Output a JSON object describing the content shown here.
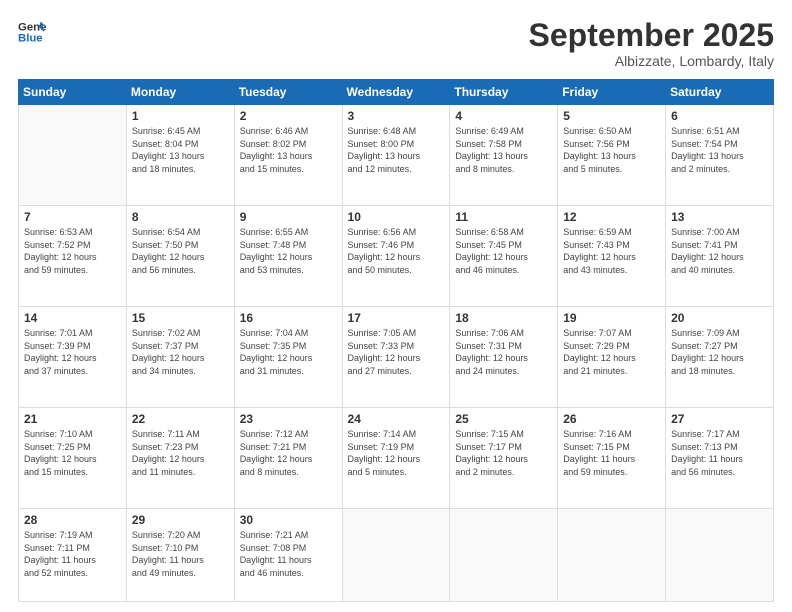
{
  "logo": {
    "line1": "General",
    "line2": "Blue"
  },
  "header": {
    "month": "September 2025",
    "location": "Albizzate, Lombardy, Italy"
  },
  "weekdays": [
    "Sunday",
    "Monday",
    "Tuesday",
    "Wednesday",
    "Thursday",
    "Friday",
    "Saturday"
  ],
  "weeks": [
    [
      {
        "day": "",
        "info": ""
      },
      {
        "day": "1",
        "info": "Sunrise: 6:45 AM\nSunset: 8:04 PM\nDaylight: 13 hours\nand 18 minutes."
      },
      {
        "day": "2",
        "info": "Sunrise: 6:46 AM\nSunset: 8:02 PM\nDaylight: 13 hours\nand 15 minutes."
      },
      {
        "day": "3",
        "info": "Sunrise: 6:48 AM\nSunset: 8:00 PM\nDaylight: 13 hours\nand 12 minutes."
      },
      {
        "day": "4",
        "info": "Sunrise: 6:49 AM\nSunset: 7:58 PM\nDaylight: 13 hours\nand 8 minutes."
      },
      {
        "day": "5",
        "info": "Sunrise: 6:50 AM\nSunset: 7:56 PM\nDaylight: 13 hours\nand 5 minutes."
      },
      {
        "day": "6",
        "info": "Sunrise: 6:51 AM\nSunset: 7:54 PM\nDaylight: 13 hours\nand 2 minutes."
      }
    ],
    [
      {
        "day": "7",
        "info": "Sunrise: 6:53 AM\nSunset: 7:52 PM\nDaylight: 12 hours\nand 59 minutes."
      },
      {
        "day": "8",
        "info": "Sunrise: 6:54 AM\nSunset: 7:50 PM\nDaylight: 12 hours\nand 56 minutes."
      },
      {
        "day": "9",
        "info": "Sunrise: 6:55 AM\nSunset: 7:48 PM\nDaylight: 12 hours\nand 53 minutes."
      },
      {
        "day": "10",
        "info": "Sunrise: 6:56 AM\nSunset: 7:46 PM\nDaylight: 12 hours\nand 50 minutes."
      },
      {
        "day": "11",
        "info": "Sunrise: 6:58 AM\nSunset: 7:45 PM\nDaylight: 12 hours\nand 46 minutes."
      },
      {
        "day": "12",
        "info": "Sunrise: 6:59 AM\nSunset: 7:43 PM\nDaylight: 12 hours\nand 43 minutes."
      },
      {
        "day": "13",
        "info": "Sunrise: 7:00 AM\nSunset: 7:41 PM\nDaylight: 12 hours\nand 40 minutes."
      }
    ],
    [
      {
        "day": "14",
        "info": "Sunrise: 7:01 AM\nSunset: 7:39 PM\nDaylight: 12 hours\nand 37 minutes."
      },
      {
        "day": "15",
        "info": "Sunrise: 7:02 AM\nSunset: 7:37 PM\nDaylight: 12 hours\nand 34 minutes."
      },
      {
        "day": "16",
        "info": "Sunrise: 7:04 AM\nSunset: 7:35 PM\nDaylight: 12 hours\nand 31 minutes."
      },
      {
        "day": "17",
        "info": "Sunrise: 7:05 AM\nSunset: 7:33 PM\nDaylight: 12 hours\nand 27 minutes."
      },
      {
        "day": "18",
        "info": "Sunrise: 7:06 AM\nSunset: 7:31 PM\nDaylight: 12 hours\nand 24 minutes."
      },
      {
        "day": "19",
        "info": "Sunrise: 7:07 AM\nSunset: 7:29 PM\nDaylight: 12 hours\nand 21 minutes."
      },
      {
        "day": "20",
        "info": "Sunrise: 7:09 AM\nSunset: 7:27 PM\nDaylight: 12 hours\nand 18 minutes."
      }
    ],
    [
      {
        "day": "21",
        "info": "Sunrise: 7:10 AM\nSunset: 7:25 PM\nDaylight: 12 hours\nand 15 minutes."
      },
      {
        "day": "22",
        "info": "Sunrise: 7:11 AM\nSunset: 7:23 PM\nDaylight: 12 hours\nand 11 minutes."
      },
      {
        "day": "23",
        "info": "Sunrise: 7:12 AM\nSunset: 7:21 PM\nDaylight: 12 hours\nand 8 minutes."
      },
      {
        "day": "24",
        "info": "Sunrise: 7:14 AM\nSunset: 7:19 PM\nDaylight: 12 hours\nand 5 minutes."
      },
      {
        "day": "25",
        "info": "Sunrise: 7:15 AM\nSunset: 7:17 PM\nDaylight: 12 hours\nand 2 minutes."
      },
      {
        "day": "26",
        "info": "Sunrise: 7:16 AM\nSunset: 7:15 PM\nDaylight: 11 hours\nand 59 minutes."
      },
      {
        "day": "27",
        "info": "Sunrise: 7:17 AM\nSunset: 7:13 PM\nDaylight: 11 hours\nand 56 minutes."
      }
    ],
    [
      {
        "day": "28",
        "info": "Sunrise: 7:19 AM\nSunset: 7:11 PM\nDaylight: 11 hours\nand 52 minutes."
      },
      {
        "day": "29",
        "info": "Sunrise: 7:20 AM\nSunset: 7:10 PM\nDaylight: 11 hours\nand 49 minutes."
      },
      {
        "day": "30",
        "info": "Sunrise: 7:21 AM\nSunset: 7:08 PM\nDaylight: 11 hours\nand 46 minutes."
      },
      {
        "day": "",
        "info": ""
      },
      {
        "day": "",
        "info": ""
      },
      {
        "day": "",
        "info": ""
      },
      {
        "day": "",
        "info": ""
      }
    ]
  ]
}
